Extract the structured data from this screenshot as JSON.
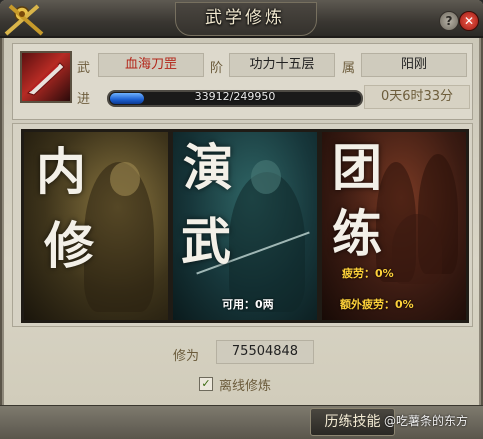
{
  "window": {
    "title": "武学修炼"
  },
  "skill": {
    "name_label": "武",
    "name": "血海刀罡",
    "level_label": "阶",
    "level": "功力十五层",
    "type_label": "属",
    "type": "阳刚",
    "progress_label": "进",
    "progress_text": "33912/249950",
    "progress_current": 33912,
    "progress_total": 249950,
    "time_remaining": "0天6时33分"
  },
  "cards": [
    {
      "id": "inner",
      "glyph_top": "内",
      "glyph_bottom": "修"
    },
    {
      "id": "perform",
      "glyph_top": "演",
      "glyph_bottom": "武",
      "stat": "可用：0两"
    },
    {
      "id": "team",
      "glyph_top": "团",
      "glyph_bottom": "练",
      "stat1": "疲劳：0%",
      "stat2": "额外疲劳：0%"
    }
  ],
  "training": {
    "label": "修为",
    "value": "75504848",
    "offline_label": "离线修炼",
    "offline_checked": true
  },
  "footer": {
    "history_button": "历练技能",
    "watermark": "@吃薯条的东方"
  },
  "icons": {
    "help": "?",
    "close": "✕",
    "check": "✓"
  },
  "colors": {
    "skill_name": "#b3271b",
    "progress_fill": "#1c5fd0",
    "stat_yellow": "#ffd23a"
  }
}
